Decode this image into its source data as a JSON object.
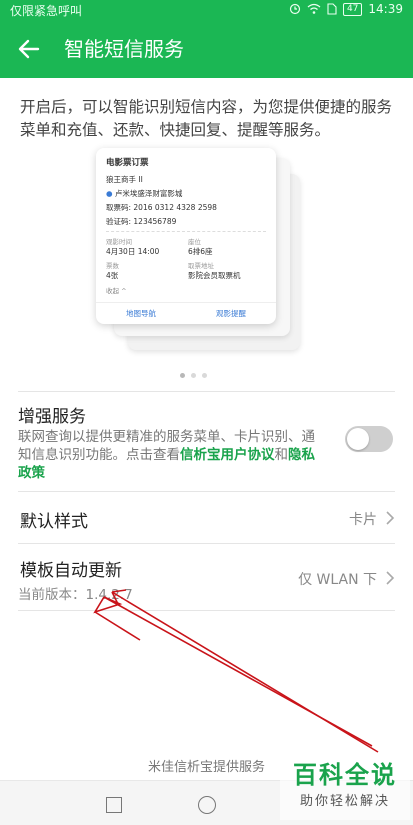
{
  "status_bar": {
    "carrier": "仅限紧急呼叫",
    "battery": "47",
    "time": "14:39"
  },
  "app_bar": {
    "title": "智能短信服务"
  },
  "intro": "开启后，可以智能识别短信内容，为您提供便捷的服务菜单和充值、还款、快捷回复、提醒等服务。",
  "card": {
    "title": "电影票订票",
    "movie": "狼王商手 II",
    "cinema": "卢米埃盛泽财富影城",
    "ticket_code": "取票码: 2016 0312 4328 2598",
    "verify_code": "验证码: 123456789",
    "time_label": "观影时间",
    "time_value": "4月30日 14:00",
    "seat_label": "座位",
    "seat_value": "6排6座",
    "count_label": "票数",
    "count_value": "4张",
    "pickup_label": "取票地址",
    "pickup_value": "影院会员取票机",
    "collapse": "收起 ^",
    "action_map": "地图导航",
    "action_remind": "观影提醒"
  },
  "enhanced": {
    "title": "增强服务",
    "desc_prefix": "联网查询以提供更精准的服务菜单、卡片识别、通知信息识别功能。点击查看",
    "link_user": "信析宝用户协议",
    "desc_and": "和",
    "link_privacy": "隐私政策",
    "enabled": false
  },
  "default_style": {
    "title": "默认样式",
    "value": "卡片"
  },
  "template_update": {
    "title": "模板自动更新",
    "value": "仅 WLAN 下",
    "version": "当前版本：1.4.2.7"
  },
  "footer": "米佳信析宝提供服务",
  "watermark": {
    "main": "百科全说",
    "sub": "助你轻松解决"
  },
  "colors": {
    "brand": "#1bb754",
    "link": "#1aa34c",
    "annotation": "#c9141a"
  }
}
